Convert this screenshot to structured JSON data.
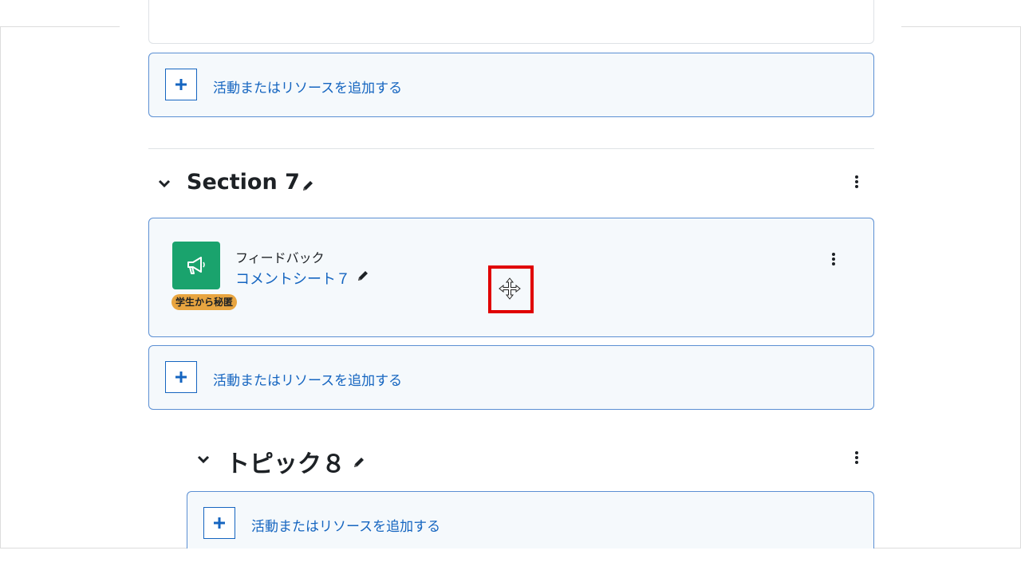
{
  "add_activity_label": "活動またはリソースを追加する",
  "section7": {
    "title": "Section 7",
    "activity": {
      "type_label": "フィードバック",
      "name": "コメントシート７",
      "badge": "学生から秘匿",
      "icon_color": "#1aa36d"
    }
  },
  "topic8": {
    "title": "トピック８"
  },
  "colors": {
    "link": "#1565c0",
    "card_border": "#5b8fd3",
    "card_bg": "#f5f9fc",
    "badge_bg": "#e8a540",
    "highlight": "#e00000"
  }
}
